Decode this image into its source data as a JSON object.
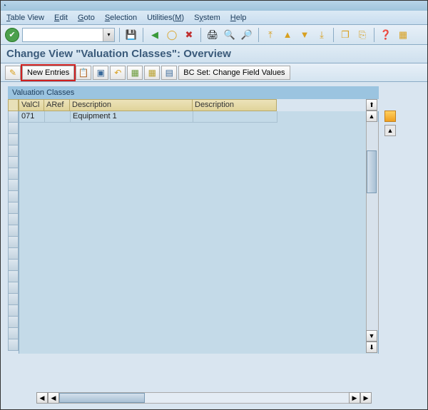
{
  "menu": {
    "items": [
      "Table View",
      "Edit",
      "Goto",
      "Selection",
      "Utilities(M)",
      "System",
      "Help"
    ]
  },
  "std_toolbar": {
    "icons": [
      "check",
      "save",
      "back",
      "exit",
      "cancel",
      "print",
      "find",
      "find-next",
      "first-page",
      "prev-page",
      "next-page",
      "last-page",
      "create-session",
      "generate-shortcut",
      "help",
      "customize"
    ]
  },
  "page_title": "Change View \"Valuation Classes\": Overview",
  "app_toolbar": {
    "change_label": "✎",
    "new_entries_label": "New Entries",
    "bc_set_label": "BC Set: Change Field Values"
  },
  "table": {
    "title": "Valuation Classes",
    "columns": [
      "ValCl",
      "ARef",
      "Description",
      "Description"
    ],
    "rows": [
      {
        "valcl": "071",
        "aref": "",
        "desc1": "Equipment 1",
        "desc2": ""
      }
    ]
  }
}
